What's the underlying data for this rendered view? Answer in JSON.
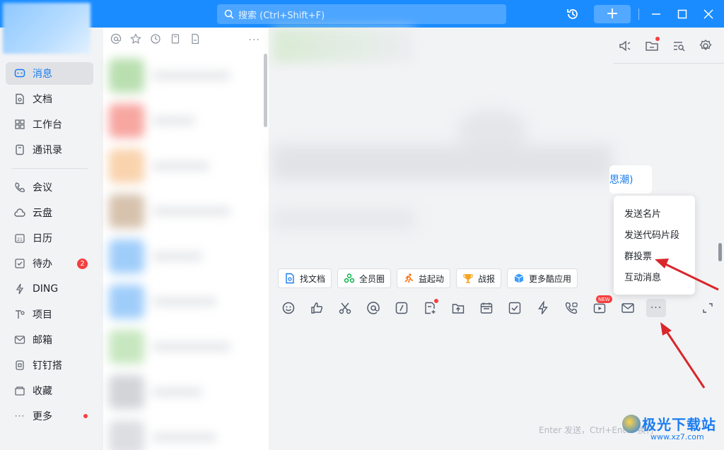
{
  "search": {
    "placeholder": "搜索 (Ctrl+Shift+F)"
  },
  "sidebar": {
    "items": [
      {
        "label": "消息",
        "icon": "message-icon",
        "active": true
      },
      {
        "label": "文档",
        "icon": "document-icon"
      },
      {
        "label": "工作台",
        "icon": "workbench-icon"
      },
      {
        "label": "通讯录",
        "icon": "contacts-icon"
      },
      {
        "label": "会议",
        "icon": "meeting-icon"
      },
      {
        "label": "云盘",
        "icon": "cloud-icon"
      },
      {
        "label": "日历",
        "icon": "calendar-icon"
      },
      {
        "label": "待办",
        "icon": "todo-icon",
        "badge": "2"
      },
      {
        "label": "DING",
        "icon": "ding-icon"
      },
      {
        "label": "项目",
        "icon": "project-icon"
      },
      {
        "label": "邮箱",
        "icon": "mail-icon"
      },
      {
        "label": "钉钉搭",
        "icon": "dingda-icon"
      },
      {
        "label": "收藏",
        "icon": "favorite-icon"
      },
      {
        "label": "更多",
        "icon": "more-icon",
        "dot": true
      }
    ]
  },
  "chat": {
    "visible_text": "思潮)",
    "quick_actions": [
      {
        "label": "找文档",
        "icon": "find-doc-icon",
        "color": "#1a7cf0"
      },
      {
        "label": "全员圈",
        "icon": "circle-icon",
        "color": "#00b042"
      },
      {
        "label": "益起动",
        "icon": "run-icon",
        "color": "#ff6a00"
      },
      {
        "label": "战报",
        "icon": "trophy-icon",
        "color": "#f5a623"
      },
      {
        "label": "更多酷应用",
        "icon": "cube-icon",
        "color": "#1a7cf0"
      }
    ],
    "new_tag": "NEW",
    "input_hint": "Enter 发送，Ctrl+Enter 换行"
  },
  "popup": {
    "items": [
      "发送名片",
      "发送代码片段",
      "群投票",
      "互动消息"
    ]
  },
  "watermark": {
    "title": "极光下载站",
    "url": "www.xz7.com"
  },
  "colors": {
    "titlebar": "#1a8cff",
    "accent": "#1a7cf0",
    "badge": "#f53f3f",
    "arrow": "#d9262b"
  }
}
